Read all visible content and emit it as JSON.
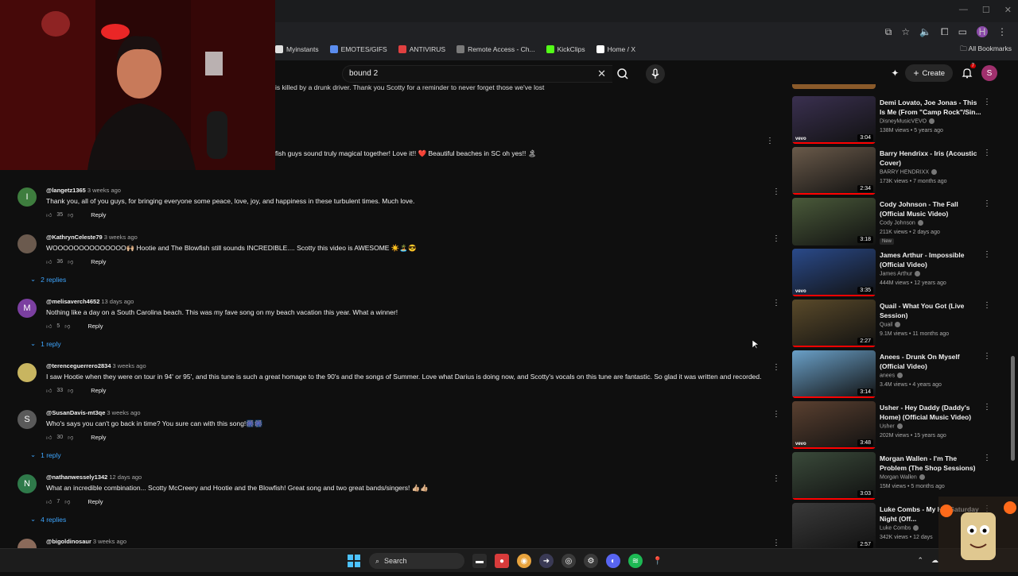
{
  "browser": {
    "bookmarks": [
      {
        "label": "Myinstants",
        "color": "#e0e0e0"
      },
      {
        "label": "EMOTES/GIFS",
        "color": "#5b8def"
      },
      {
        "label": "ANTIVIRUS",
        "color": "#e04040"
      },
      {
        "label": "Remote Access - Ch...",
        "color": "#7a7a7a"
      },
      {
        "label": "KickClips",
        "color": "#53fc18"
      },
      {
        "label": "Home / X",
        "color": "#ffffff"
      }
    ],
    "all_bookmarks": "All Bookmarks",
    "profile_initial": "H"
  },
  "youtube": {
    "search_value": "bound 2",
    "create_label": "Create",
    "notification_count": "7",
    "avatar_initial": "S"
  },
  "snippets": {
    "top1": "is killed by a drunk driver. Thank you Scotty for a reminder to never forget those we've lost",
    "top2": "fish guys sound truly magical together! Love it!! ❤️ Beautiful beaches in SC oh yes!! 🏝"
  },
  "comments": [
    {
      "initial": "I",
      "avatar_color": "#3e7d3e",
      "author": "@langetz1365",
      "time": "3 weeks ago",
      "text": "Thank you, all of you guys, for bringing everyone some peace, love, joy, and happiness in these turbulent times. Much love.",
      "likes": "35",
      "reply": "Reply"
    },
    {
      "initial": "",
      "avatar_color": "#6b5a4e",
      "author": "@KathrynCeleste79",
      "time": "3 weeks ago",
      "text": "WOOOOOOOOOOOOOO🙌🏼 Hootie and The Blowfish still sounds INCREDIBLE.... Scotty this video is AWESOME ☀️🏝️😎",
      "likes": "36",
      "reply": "Reply",
      "replies": "2 replies"
    },
    {
      "initial": "M",
      "avatar_color": "#7b3fa0",
      "author": "@melisaverch4652",
      "time": "13 days ago",
      "text": "Nothing like a day on a South Carolina beach. This was my fave song on my beach vacation this year.  What a winner!",
      "likes": "5",
      "reply": "Reply",
      "replies": "1 reply"
    },
    {
      "initial": "",
      "avatar_color": "#c8b560",
      "author": "@terenceguerrero2834",
      "time": "3 weeks ago",
      "text": "I saw Hootie when they were on tour in 94' or 95', and this tune is such a great homage to the 90's and the songs of Summer. Love what Darius is doing now, and Scotty's vocals on this tune are fantastic. So glad it was written and recorded.",
      "likes": "33",
      "reply": "Reply"
    },
    {
      "initial": "S",
      "avatar_color": "#5a5a5a",
      "author": "@SusanDavis-mt3qe",
      "time": "3 weeks ago",
      "text": "Who's says you can't go back in time?  You sure can with this song!🎆🎆",
      "likes": "30",
      "reply": "Reply",
      "replies": "1 reply"
    },
    {
      "initial": "N",
      "avatar_color": "#2f7a4a",
      "author": "@nathanwessely1342",
      "time": "12 days ago",
      "text": "What an incredible combination... Scotty McCreery and Hootie and the Blowfish! Great song and two great bands/singers! 👍🏼👍🏼",
      "likes": "7",
      "reply": "Reply",
      "replies": "4 replies"
    },
    {
      "initial": "",
      "avatar_color": "#8a6a5a",
      "author": "@bigoldinosaur",
      "time": "3 weeks ago",
      "text": "",
      "likes": "",
      "reply": ""
    }
  ],
  "recommendations": [
    {
      "title": "Demi Lovato, Joe Jonas - This Is Me (From \"Camp Rock\"/Sin...",
      "channel": "DisneyMusicVEVO",
      "meta": "138M views • 5 years ago",
      "duration": "3:04",
      "thumb_color": "#3a3050",
      "vevo": true,
      "progress": 1.0
    },
    {
      "title": "Barry Hendrixx - Iris (Acoustic Cover)",
      "channel": "BARRY HENDRIXX",
      "meta": "173K views • 7 months ago",
      "duration": "2:34",
      "thumb_color": "#6a5a4a",
      "vevo": false,
      "progress": 1.0
    },
    {
      "title": "Cody Johnson - The Fall (Official Music Video)",
      "channel": "Cody Johnson",
      "meta": "211K views • 2 days ago",
      "duration": "3:18",
      "thumb_color": "#4a5a3a",
      "vevo": false,
      "progress": 0,
      "badge": "New"
    },
    {
      "title": "James Arthur - Impossible (Official Video)",
      "channel": "James Arthur",
      "meta": "444M views • 12 years ago",
      "duration": "3:35",
      "thumb_color": "#2a4a8a",
      "vevo": true,
      "progress": 1.0
    },
    {
      "title": "Quail - What You Got (Live Session)",
      "channel": "Quail",
      "meta": "9.1M views • 11 months ago",
      "duration": "2:27",
      "thumb_color": "#5a4a2a",
      "vevo": false,
      "progress": 1.0
    },
    {
      "title": "Anees - Drunk On Myself (Official Video)",
      "channel": "anees",
      "meta": "3.4M views • 4 years ago",
      "duration": "3:14",
      "thumb_color": "#6aa0c8",
      "vevo": false,
      "progress": 1.0
    },
    {
      "title": "Usher - Hey Daddy (Daddy's Home) (Official Music Video)",
      "channel": "Usher",
      "meta": "202M views • 15 years ago",
      "duration": "3:48",
      "thumb_color": "#5a4030",
      "vevo": true,
      "progress": 1.0
    },
    {
      "title": "Morgan Wallen - I'm The Problem (The Shop Sessions)",
      "channel": "Morgan Wallen",
      "meta": "15M views • 5 months ago",
      "duration": "3:03",
      "thumb_color": "#3a4a3a",
      "vevo": false,
      "progress": 1.0
    },
    {
      "title": "Luke Combs - My H... Saturday Night (Off...",
      "channel": "Luke Combs",
      "meta": "342K views • 12 days",
      "duration": "2:57",
      "thumb_color": "#3a3a3a",
      "vevo": false,
      "progress": 0
    }
  ],
  "taskbar": {
    "search_label": "Search"
  }
}
